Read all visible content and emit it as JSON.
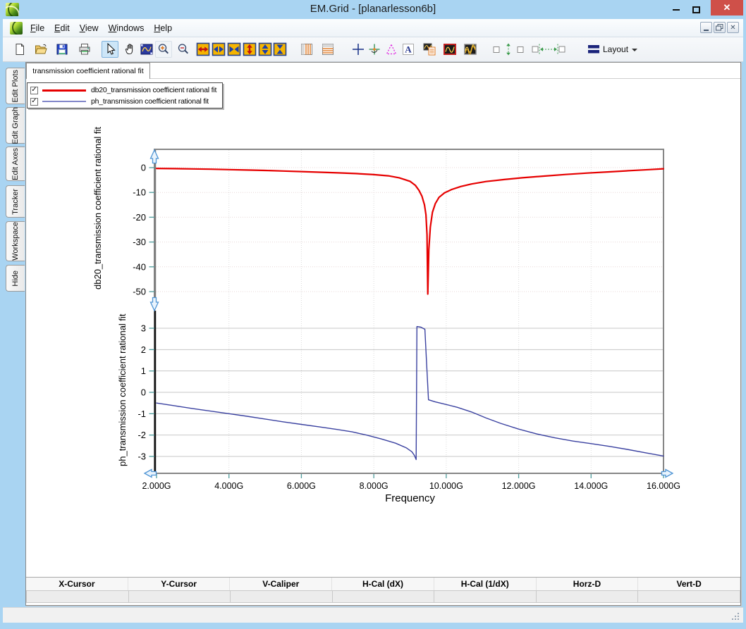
{
  "window": {
    "title": "EM.Grid - [planarlesson6b]",
    "controls": {
      "minimize": "minimize",
      "maximize": "maximize",
      "close_glyph": "✕"
    },
    "child_controls": {
      "minimize": "minimize",
      "restore": "restore",
      "close_glyph": "✕"
    }
  },
  "menu": {
    "items": [
      "File",
      "Edit",
      "View",
      "Windows",
      "Help"
    ]
  },
  "toolbar": {
    "layout_label": "Layout",
    "icons": [
      "new-file",
      "open-file",
      "save",
      "print",
      "select-arrow",
      "pan-hand",
      "zoom-region",
      "zoom-in",
      "zoom-out",
      "expand-x",
      "arrows-x-out",
      "arrows-x-in",
      "expand-y",
      "arrows-y-out",
      "arrows-y-in",
      "stripes-vertical",
      "stripes-horizontal",
      "crosshair",
      "tracker-axes",
      "caliper-triangle",
      "text-annotation",
      "plot-with-table",
      "single-plot",
      "dual-plot",
      "vertical-spacing",
      "horizontal-spacing",
      "layout-menu"
    ]
  },
  "sidebar": {
    "tabs": [
      "Edit Plots",
      "Edit Graph",
      "Edit Axes",
      "Tracker",
      "Workspace",
      "Hide"
    ]
  },
  "doc_tab": {
    "label": "transmission coefficient rational fit"
  },
  "legend": {
    "checkmark": "✓",
    "items": [
      {
        "label": "db20_transmission coefficient rational fit",
        "color": "#e60000",
        "sample_color": "#e60000",
        "thickness": 3,
        "checked": true
      },
      {
        "label": "ph_transmission coefficient rational fit",
        "color": "#3a41a0",
        "sample_color": "#8287c9",
        "thickness": 2,
        "checked": true
      }
    ]
  },
  "chart_data": {
    "type": "line",
    "xlabel": "Frequency",
    "x_unit": "GHz",
    "x_range": [
      2,
      16
    ],
    "x_tick_values": [
      2,
      4,
      6,
      8,
      10,
      12,
      14,
      16
    ],
    "x_tick_labels": [
      "2.000G",
      "4.000G",
      "6.000G",
      "8.000G",
      "10.000G",
      "12.000G",
      "14.000G",
      "16.000G"
    ],
    "grid": true,
    "legend_position": "top-left",
    "subplots": [
      {
        "ylabel": "db20_transmission coefficient rational fit",
        "y_ticks": [
          0,
          -10,
          -20,
          -30,
          -40,
          -50
        ],
        "y_range": [
          -55,
          7
        ],
        "series": {
          "name": "db20_transmission coefficient rational fit",
          "color": "#e60000",
          "width": 2.2,
          "points": [
            [
              2,
              -0.3
            ],
            [
              2.5,
              -0.4
            ],
            [
              3,
              -0.5
            ],
            [
              3.5,
              -0.63
            ],
            [
              4,
              -0.8
            ],
            [
              4.5,
              -0.97
            ],
            [
              5,
              -1.15
            ],
            [
              5.5,
              -1.35
            ],
            [
              6,
              -1.6
            ],
            [
              6.5,
              -1.85
            ],
            [
              7,
              -2.1
            ],
            [
              7.5,
              -2.4
            ],
            [
              8,
              -2.8
            ],
            [
              8.4,
              -3.3
            ],
            [
              8.7,
              -4.1
            ],
            [
              9,
              -5.5
            ],
            [
              9.15,
              -7.2
            ],
            [
              9.25,
              -9.2
            ],
            [
              9.33,
              -11.5
            ],
            [
              9.4,
              -15
            ],
            [
              9.44,
              -19
            ],
            [
              9.47,
              -27
            ],
            [
              9.49,
              -51
            ],
            [
              9.52,
              -33
            ],
            [
              9.56,
              -24
            ],
            [
              9.62,
              -18
            ],
            [
              9.7,
              -14.5
            ],
            [
              9.8,
              -12
            ],
            [
              9.95,
              -10.2
            ],
            [
              10.15,
              -8.8
            ],
            [
              10.4,
              -7.6
            ],
            [
              10.7,
              -6.6
            ],
            [
              11.1,
              -5.6
            ],
            [
              11.6,
              -4.8
            ],
            [
              12.1,
              -4.1
            ],
            [
              12.7,
              -3.4
            ],
            [
              13.3,
              -2.75
            ],
            [
              13.9,
              -2.2
            ],
            [
              14.5,
              -1.7
            ],
            [
              15.1,
              -1.2
            ],
            [
              15.6,
              -0.8
            ],
            [
              16,
              -0.45
            ]
          ]
        }
      },
      {
        "ylabel": "ph_transmission coefficient rational fit",
        "y_ticks": [
          3,
          2,
          1,
          0,
          -1,
          -2,
          -3
        ],
        "y_range": [
          -3.8,
          3.9
        ],
        "series": {
          "name": "ph_transmission coefficient rational fit",
          "color": "#3a41a0",
          "width": 1.4,
          "points": [
            [
              2,
              -0.5
            ],
            [
              2.5,
              -0.63
            ],
            [
              3,
              -0.76
            ],
            [
              3.5,
              -0.88
            ],
            [
              4,
              -1.0
            ],
            [
              4.5,
              -1.12
            ],
            [
              5,
              -1.25
            ],
            [
              5.5,
              -1.38
            ],
            [
              6,
              -1.5
            ],
            [
              6.5,
              -1.62
            ],
            [
              7,
              -1.74
            ],
            [
              7.4,
              -1.85
            ],
            [
              7.8,
              -2.0
            ],
            [
              8.2,
              -2.18
            ],
            [
              8.6,
              -2.38
            ],
            [
              8.9,
              -2.6
            ],
            [
              9.05,
              -2.78
            ],
            [
              9.12,
              -2.95
            ],
            [
              9.17,
              -3.15
            ],
            [
              9.19,
              3.08
            ],
            [
              9.3,
              3.05
            ],
            [
              9.41,
              2.95
            ],
            [
              9.46,
              1.3
            ],
            [
              9.51,
              -0.35
            ],
            [
              9.7,
              -0.45
            ],
            [
              10,
              -0.57
            ],
            [
              10.3,
              -0.7
            ],
            [
              10.7,
              -0.92
            ],
            [
              11.1,
              -1.2
            ],
            [
              11.5,
              -1.45
            ],
            [
              12,
              -1.72
            ],
            [
              12.5,
              -1.95
            ],
            [
              13,
              -2.13
            ],
            [
              13.5,
              -2.28
            ],
            [
              14,
              -2.4
            ],
            [
              14.5,
              -2.53
            ],
            [
              15,
              -2.67
            ],
            [
              15.5,
              -2.83
            ],
            [
              16,
              -2.98
            ]
          ]
        }
      }
    ]
  },
  "cursor_table": {
    "headers": [
      "X-Cursor",
      "Y-Cursor",
      "V-Caliper",
      "H-Cal (dX)",
      "H-Cal (1/dX)",
      "Horz-D",
      "Vert-D"
    ],
    "values": [
      "",
      "",
      "",
      "",
      "",
      "",
      ""
    ]
  },
  "colors": {
    "window_chrome": "#a9d4f2",
    "close_button": "#cf5049",
    "tick_color": "#4d9b9b",
    "grid_vertical": "#dcdcdc",
    "grid_top_horizontal": "#e8d7d7",
    "grid_bottom_horizontal": "#c7c7c7",
    "frame": "#868686",
    "handle_fill": "#eaf4fd",
    "handle_stroke": "#4e94d4",
    "icon_yellow": "#f5b400"
  }
}
